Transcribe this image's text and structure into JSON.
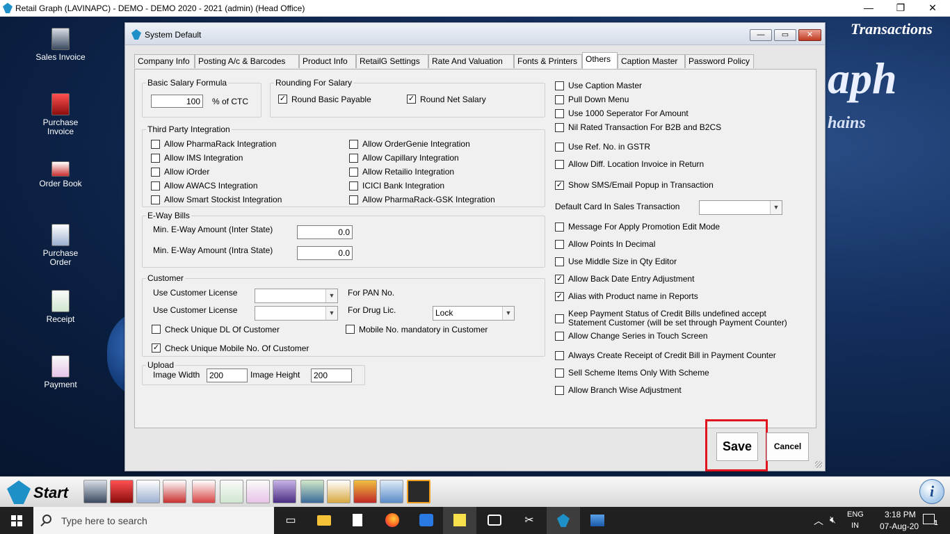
{
  "app": {
    "title": "Retail Graph (LAVINAPC) - DEMO - DEMO  2020 - 2021 (admin) (Head Office)",
    "controls": {
      "minimize": "—",
      "maximize": "❐",
      "close": "✕"
    }
  },
  "background": {
    "header_text": "Transactions",
    "logo_text": "aph",
    "subtitle_text": "hains"
  },
  "desktop": {
    "icons": [
      {
        "label": "Sales Invoice",
        "name": "sales-invoice-icon"
      },
      {
        "label": "Purchase Invoice",
        "name": "purchase-invoice-icon"
      },
      {
        "label": "Order Book",
        "name": "order-book-icon"
      },
      {
        "label": "Purchase Order",
        "name": "purchase-order-icon"
      },
      {
        "label": "Receipt",
        "name": "receipt-icon"
      },
      {
        "label": "Payment",
        "name": "payment-icon"
      }
    ]
  },
  "dialog": {
    "title": "System Default",
    "controls": {
      "minimize": "—",
      "maximize": "▭",
      "close": "✕"
    },
    "tabs": [
      "Company Info",
      "Posting A/c & Barcodes",
      "Product Info",
      "RetailG Settings",
      "Rate And Valuation",
      "Fonts & Printers",
      "Others",
      "Caption Master",
      "Password Policy"
    ],
    "active_tab": "Others",
    "basic_salary": {
      "title": "Basic Salary Formula",
      "value": "100",
      "suffix": "% of CTC"
    },
    "rounding": {
      "title": "Rounding For Salary",
      "basic": "Round Basic Payable",
      "net": "Round Net Salary"
    },
    "third_party": {
      "title": "Third Party Integration",
      "items": [
        "Allow PharmaRack Integration",
        "Allow IMS Integration",
        "Allow iOrder",
        "Allow AWACS Integration",
        "Allow Smart Stockist Integration",
        "Allow OrderGenie Integration",
        "Allow Capillary Integration",
        "Allow Retailio Integration",
        "ICICI Bank Integration",
        "Allow PharmaRack-GSK Integration"
      ]
    },
    "eway": {
      "title": "E-Way Bills",
      "inter_label": "Min. E-Way Amount (Inter State)",
      "inter_value": "0.0",
      "intra_label": "Min. E-Way Amount (Intra State)",
      "intra_value": "0.0"
    },
    "customer": {
      "title": "Customer",
      "license_label_1": "Use Customer License",
      "pan_label": "For PAN No.",
      "license_label_2": "Use Customer License",
      "drug_label": "For Drug Lic.",
      "drug_value": "Lock",
      "unique_dl": "Check Unique DL Of Customer",
      "mobile_mandatory": "Mobile No. mandatory in Customer",
      "unique_mobile": "Check Unique Mobile No. Of Customer"
    },
    "upload": {
      "title": "Upload",
      "width_label": "Image Width",
      "width_value": "200",
      "height_label": "Image Height",
      "height_value": "200"
    },
    "right_options": [
      {
        "label": "Use Caption Master",
        "checked": false
      },
      {
        "label": "Pull Down Menu",
        "checked": false
      },
      {
        "label": "Use 1000 Seperator For Amount",
        "checked": false
      },
      {
        "label": "Nil Rated Transaction For B2B and B2CS",
        "checked": false
      },
      {
        "label": "Use Ref. No. in GSTR",
        "checked": false
      },
      {
        "label": "Allow Diff. Location Invoice in Return",
        "checked": false
      },
      {
        "label": "Show SMS/Email Popup in Transaction",
        "checked": true
      },
      {
        "label": "Message For Apply Promotion Edit Mode",
        "checked": false
      },
      {
        "label": "Allow Points In Decimal",
        "checked": false
      },
      {
        "label": "Use Middle Size in Qty Editor",
        "checked": false
      },
      {
        "label": "Allow Back Date Entry Adjustment",
        "checked": true
      },
      {
        "label": "Alias with Product name in Reports",
        "checked": true
      },
      {
        "label": "Keep Payment Status of Credit Bills undefined accept",
        "label2": " Statement Customer (will be set through Payment Counter)",
        "checked": false
      },
      {
        "label": "Allow Change Series in Touch Screen",
        "checked": false
      },
      {
        "label": "Always Create Receipt of Credit Bill in Payment Counter",
        "checked": false
      },
      {
        "label": "Sell Scheme Items Only With Scheme",
        "checked": false
      },
      {
        "label": "Allow Branch Wise Adjustment",
        "checked": false
      }
    ],
    "default_card_label": "Default Card In Sales Transaction",
    "save": "Save",
    "cancel": "Cancel"
  },
  "app_taskbar": {
    "start": "Start"
  },
  "taskbar": {
    "search_placeholder": "Type here to search",
    "lang1": "ENG",
    "lang2": "IN",
    "time": "3:18 PM",
    "date": "07-Aug-20",
    "notifications": "1"
  },
  "colors": {
    "highlight": "#e0141e",
    "desktop": "#0c2b53"
  }
}
